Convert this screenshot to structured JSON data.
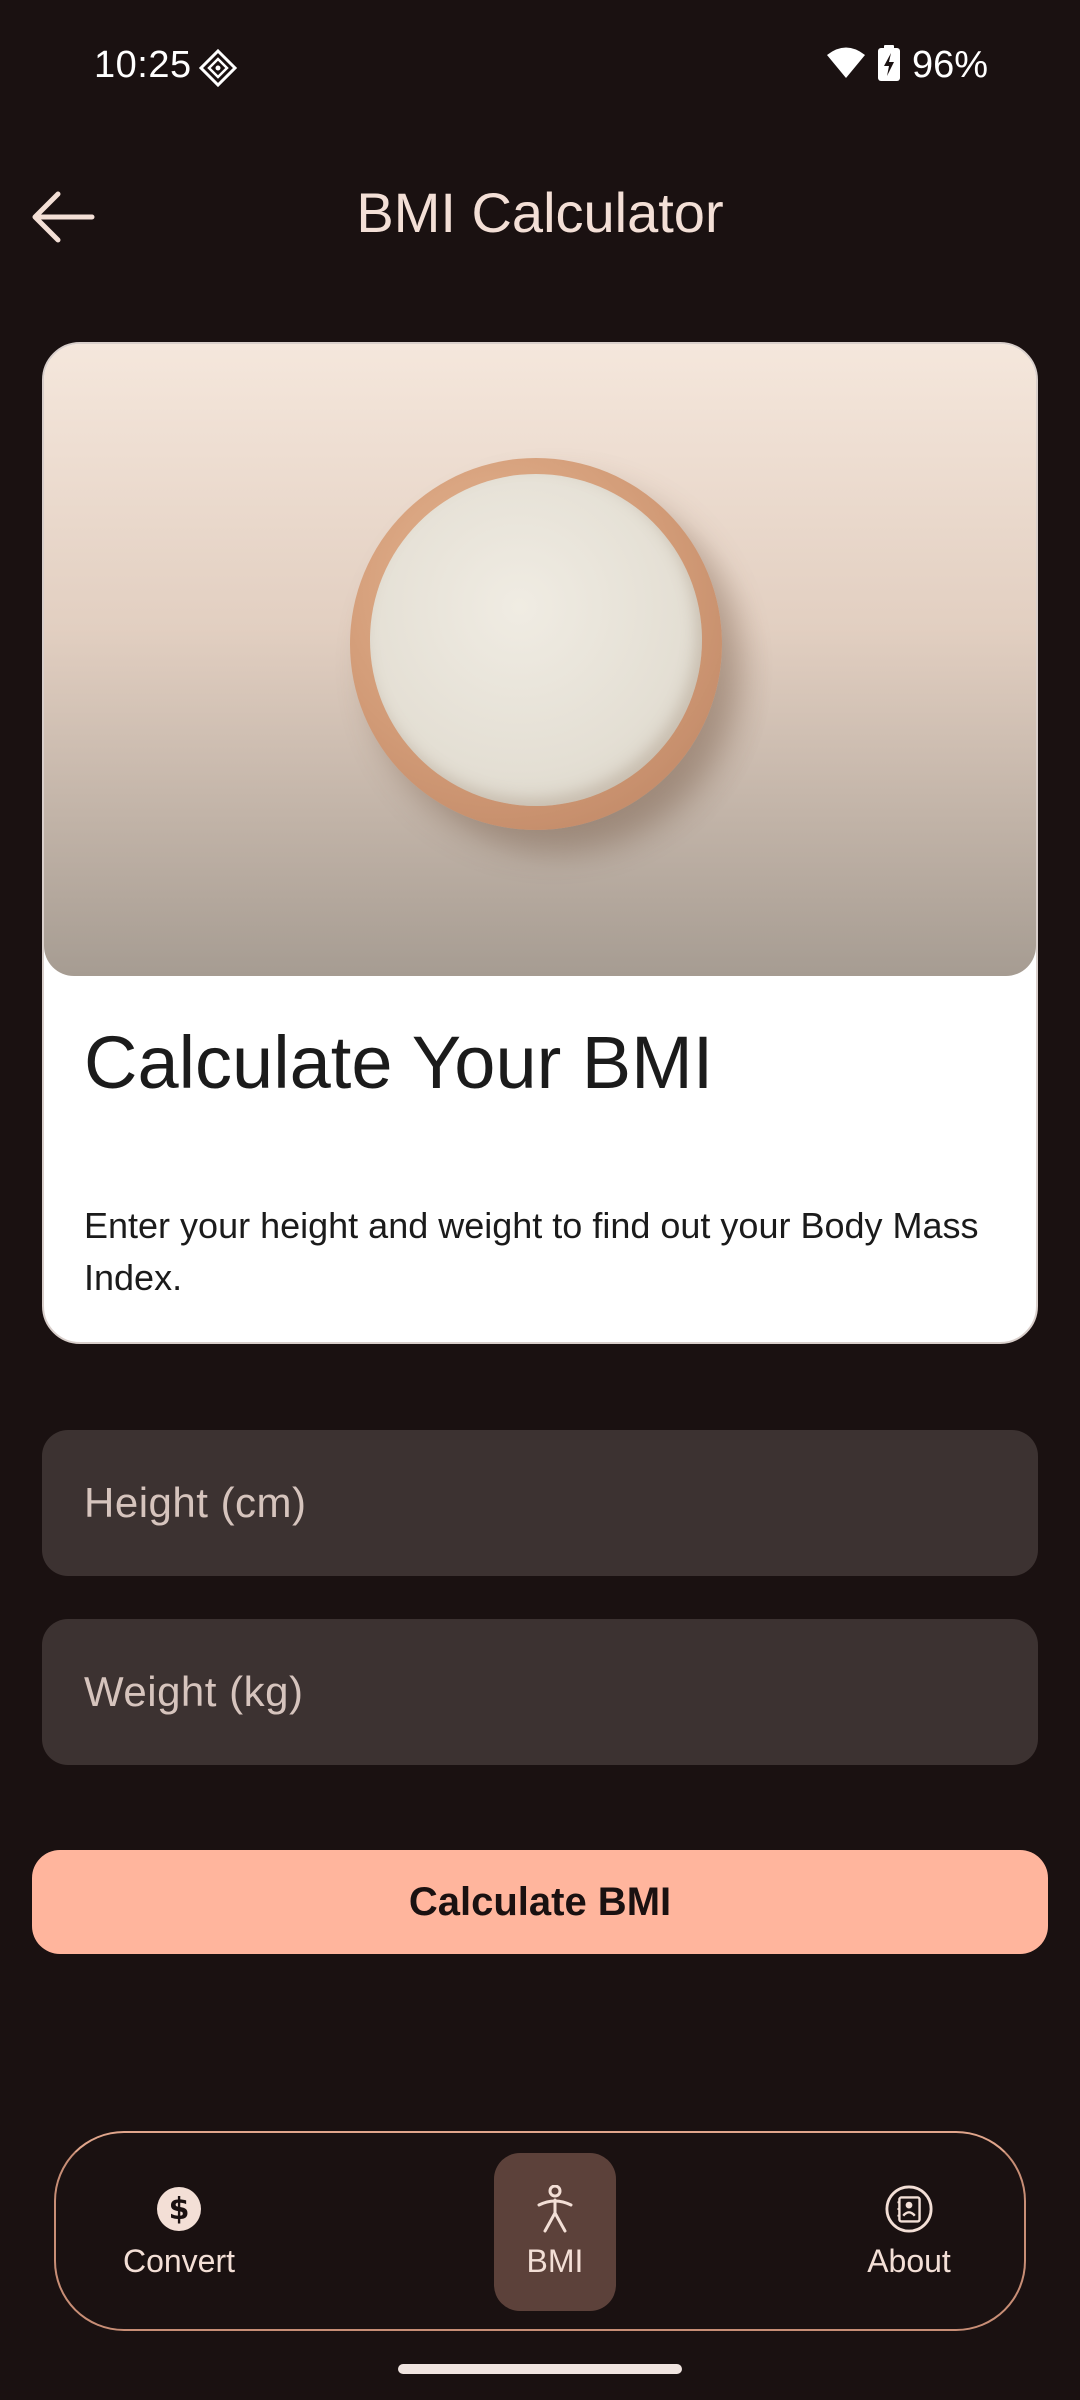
{
  "status_bar": {
    "time": "10:25",
    "battery": "96%"
  },
  "app_bar": {
    "title": "BMI Calculator",
    "back_icon": "arrow-left-icon"
  },
  "card": {
    "heading": "Calculate Your BMI",
    "description": "Enter your height and weight to find out your Body Mass Index."
  },
  "form": {
    "height_placeholder": "Height (cm)",
    "weight_placeholder": "Weight (kg)",
    "height_value": "",
    "weight_value": "",
    "calculate_label": "Calculate BMI"
  },
  "bottom_nav": {
    "items": [
      {
        "label": "Convert",
        "icon": "dollar-icon",
        "active": false
      },
      {
        "label": "BMI",
        "icon": "person-icon",
        "active": true
      },
      {
        "label": "About",
        "icon": "contact-icon",
        "active": false
      }
    ]
  },
  "colors": {
    "background": "#1a1111",
    "accent": "#ffb59d",
    "input_bg": "#3c3231",
    "active_nav_bg": "#5c413a",
    "text_on_dark": "#f3dfd6"
  }
}
